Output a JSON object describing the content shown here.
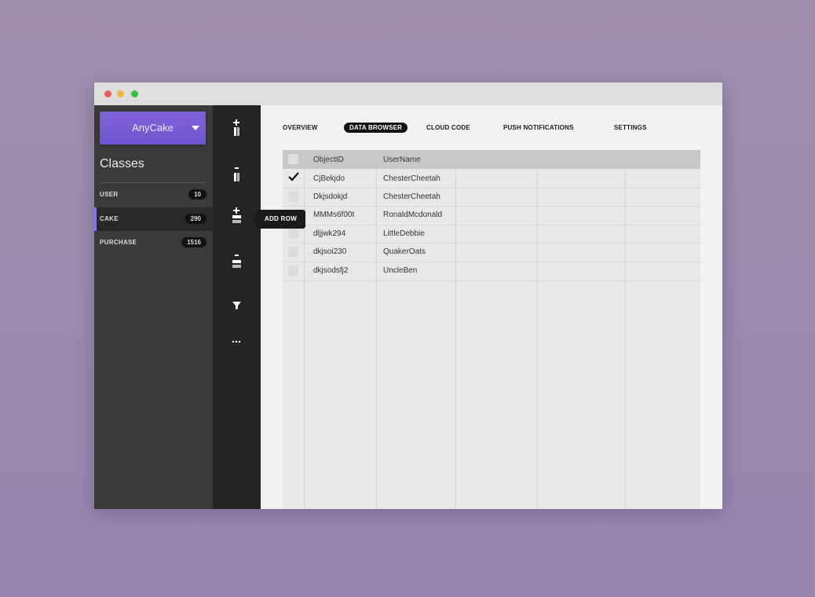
{
  "app": {
    "name": "AnyCake"
  },
  "sidebar": {
    "title": "Classes",
    "classes": [
      {
        "label": "USER",
        "count": "10",
        "active": false
      },
      {
        "label": "CAKE",
        "count": "290",
        "active": true
      },
      {
        "label": "PURCHASE",
        "count": "1516",
        "active": false
      }
    ]
  },
  "toolbar": {
    "tools": [
      {
        "icon": "add-column-icon"
      },
      {
        "icon": "remove-column-icon"
      },
      {
        "icon": "add-row-icon"
      },
      {
        "icon": "remove-row-icon"
      },
      {
        "icon": "filter-icon"
      },
      {
        "icon": "more-icon"
      }
    ],
    "tooltip": "ADD ROW"
  },
  "nav": {
    "tabs": [
      {
        "label": "OVERVIEW",
        "active": false
      },
      {
        "label": "DATA BROWSER",
        "active": true
      },
      {
        "label": "CLOUD CODE",
        "active": false
      },
      {
        "label": "PUSH NOTIFICATIONS",
        "active": false
      },
      {
        "label": "SETTINGS",
        "active": false
      }
    ]
  },
  "table": {
    "headers": [
      "ObjectID",
      "UserName"
    ],
    "rows": [
      {
        "object_id": "CjBekjdo",
        "username": "ChesterCheetah",
        "checked": true
      },
      {
        "object_id": "Dkjsdokjd",
        "username": "ChesterCheetah",
        "checked": false
      },
      {
        "object_id": "MMMs6f00t",
        "username": "RonaldMcdonald",
        "checked": false
      },
      {
        "object_id": "dljjwk294",
        "username": "LittleDebbie",
        "checked": false
      },
      {
        "object_id": "dkjsoi230",
        "username": "QuakerOats",
        "checked": false
      },
      {
        "object_id": "dkjsodsfj2",
        "username": "UncleBen",
        "checked": false
      }
    ]
  },
  "colors": {
    "accent": "#7e62db",
    "sidebar": "#3a3a3a",
    "toolbar": "#242424"
  }
}
